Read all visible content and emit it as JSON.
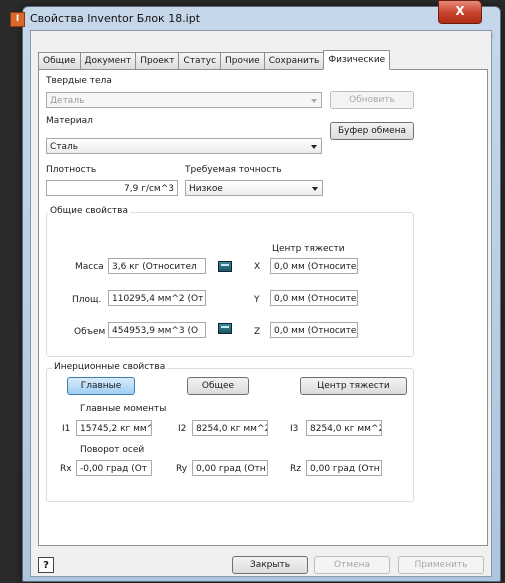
{
  "window": {
    "title": "Свойства Inventor Блок 18.ipt",
    "close_glyph": "X"
  },
  "tabs": [
    {
      "label": "Общие"
    },
    {
      "label": "Документ"
    },
    {
      "label": "Проект"
    },
    {
      "label": "Статус"
    },
    {
      "label": "Прочие"
    },
    {
      "label": "Сохранить"
    },
    {
      "label": "Физические",
      "active": true
    }
  ],
  "solids": {
    "label": "Твердые тела",
    "value": "Деталь",
    "update_button": "Обновить"
  },
  "material": {
    "label": "Материал",
    "value": "Сталь",
    "clipboard_button": "Буфер обмена"
  },
  "density": {
    "label": "Плотность",
    "value": "7,9 г/см^3"
  },
  "accuracy": {
    "label": "Требуемая точность",
    "value": "Низкое"
  },
  "general": {
    "title": "Общие свойства",
    "center_of_gravity_label": "Центр тяжести",
    "mass_label": "Масса",
    "mass_value": "3,6 кг (Относител",
    "area_label": "Площ.",
    "area_value": "110295,4 мм^2 (От",
    "volume_label": "Объем",
    "volume_value": "454953,9 мм^3 (О",
    "x_label": "X",
    "x_value": "0,0 мм (Относител",
    "y_label": "Y",
    "y_value": "0,0 мм (Относител",
    "z_label": "Z",
    "z_value": "0,0 мм (Относител"
  },
  "inertia": {
    "title": "Инерционные свойства",
    "main_button": "Главные",
    "general_button": "Общее",
    "cog_button": "Центр тяжести",
    "principal_moments_label": "Главные моменты",
    "i1_label": "I1",
    "i1_value": "15745,2 кг мм^",
    "i2_label": "I2",
    "i2_value": "8254,0 кг мм^2",
    "i3_label": "I3",
    "i3_value": "8254,0 кг мм^2",
    "rotation_label": "Поворот осей",
    "rx_label": "Rx",
    "rx_value": "-0,00 град (От",
    "ry_label": "Ry",
    "ry_value": "0,00 град (Отн",
    "rz_label": "Rz",
    "rz_value": "0,00 град (Отн"
  },
  "footer": {
    "help_glyph": "?",
    "close_button": "Закрыть",
    "cancel_button": "Отмена",
    "apply_button": "Применить"
  }
}
